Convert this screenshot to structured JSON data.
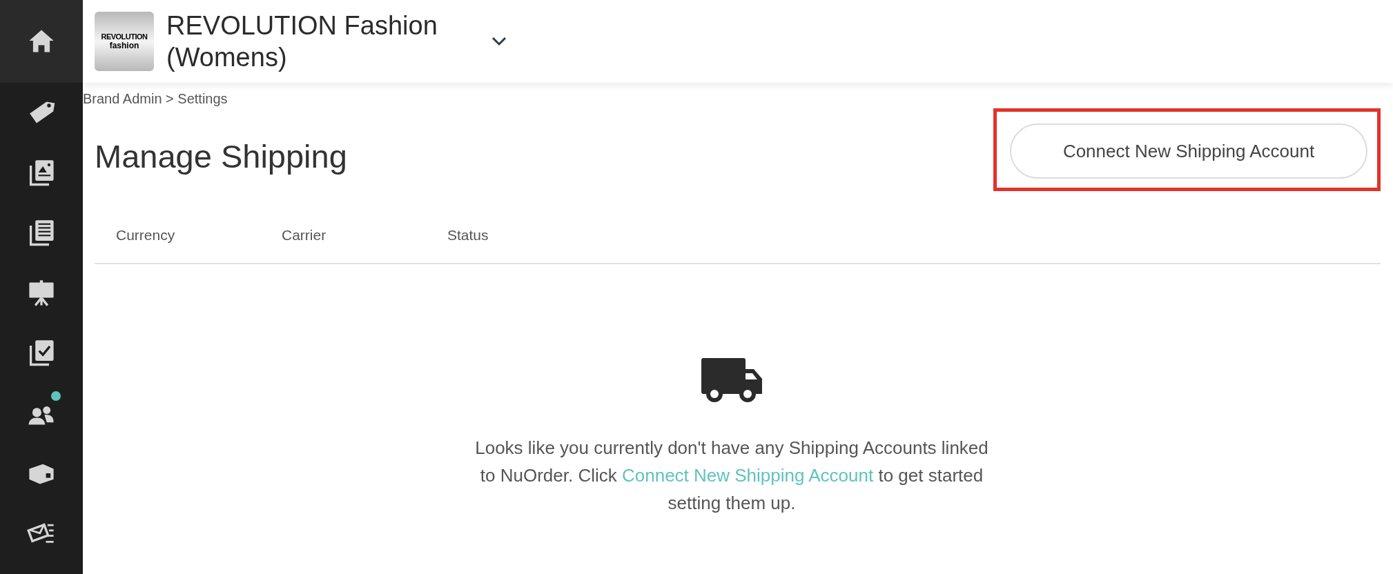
{
  "sidebar": {
    "items": [
      {
        "kind": "home",
        "selected": true,
        "notification": false
      },
      {
        "kind": "tag",
        "selected": false,
        "notification": false
      },
      {
        "kind": "gallery",
        "selected": false,
        "notification": false
      },
      {
        "kind": "list",
        "selected": false,
        "notification": false
      },
      {
        "kind": "presentation",
        "selected": false,
        "notification": false
      },
      {
        "kind": "checklist",
        "selected": false,
        "notification": false
      },
      {
        "kind": "users",
        "selected": false,
        "notification": true
      },
      {
        "kind": "box",
        "selected": false,
        "notification": false
      },
      {
        "kind": "mail",
        "selected": false,
        "notification": false
      }
    ]
  },
  "header": {
    "logo": [
      "REVOLUTION",
      "fashion"
    ],
    "brand": "REVOLUTION Fashion (Womens)"
  },
  "breadcrumb": "Brand Admin > Settings",
  "page_title": "Manage Shipping",
  "connect_button": {
    "label": "Connect New Shipping Account",
    "highlighted": true
  },
  "table": {
    "columns": [
      "Currency",
      "Carrier",
      "Status"
    ]
  },
  "empty_state": {
    "text_before": "Looks like you currently don't have any Shipping Accounts linked to NuOrder. Click",
    "link": "Connect New Shipping Account",
    "text_after": "to get started setting them up."
  }
}
